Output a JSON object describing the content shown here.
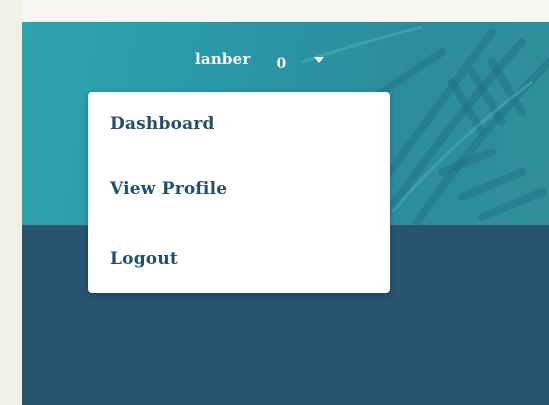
{
  "header": {
    "username": "lanber",
    "notification_count": "0"
  },
  "user_menu": {
    "items": [
      {
        "label": "Dashboard"
      },
      {
        "label": "View Profile"
      },
      {
        "label": "Logout"
      }
    ]
  },
  "colors": {
    "banner_teal": "#2a98a8",
    "lower_panel": "#275470",
    "menu_text": "#1f4f6b",
    "page_background": "#eef1e3"
  }
}
